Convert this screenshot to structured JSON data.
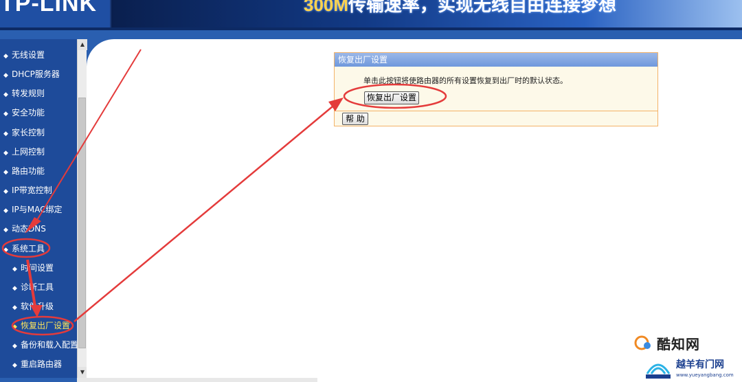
{
  "header": {
    "logo": "TP-LINK",
    "slogan_number": "300M",
    "slogan_text": "传输速率，实现无线自由连接梦想"
  },
  "sidebar": {
    "items": [
      {
        "label": "无线设置",
        "level": "top"
      },
      {
        "label": "DHCP服务器",
        "level": "top"
      },
      {
        "label": "转发规则",
        "level": "top"
      },
      {
        "label": "安全功能",
        "level": "top"
      },
      {
        "label": "家长控制",
        "level": "top"
      },
      {
        "label": "上网控制",
        "level": "top"
      },
      {
        "label": "路由功能",
        "level": "top"
      },
      {
        "label": "IP带宽控制",
        "level": "top"
      },
      {
        "label": "IP与MAC绑定",
        "level": "top"
      },
      {
        "label": "动态DNS",
        "level": "top"
      },
      {
        "label": "系统工具",
        "level": "top"
      },
      {
        "label": "时间设置",
        "level": "sub"
      },
      {
        "label": "诊断工具",
        "level": "sub"
      },
      {
        "label": "软件升级",
        "level": "sub"
      },
      {
        "label": "恢复出厂设置",
        "level": "sub",
        "active": true
      },
      {
        "label": "备份和载入配置",
        "level": "sub"
      },
      {
        "label": "重启路由器",
        "level": "sub"
      }
    ]
  },
  "panel": {
    "title": "恢复出厂设置",
    "description": "单击此按钮将使路由器的所有设置恢复到出厂时的默认状态。",
    "restore_button": "恢复出厂设置",
    "help_button": "帮 助"
  },
  "watermarks": {
    "brand1": "酷知网",
    "brand2": "越羊有门网",
    "brand2_url": "www.yueyangbang.com"
  },
  "colors": {
    "header_blue": "#1a3a78",
    "sidebar_blue": "#1e4b9a",
    "panel_border": "#f3b267",
    "panel_bg": "#fdf9e9",
    "active_text": "#ffe65c",
    "annotation_red": "#e43b3b"
  }
}
